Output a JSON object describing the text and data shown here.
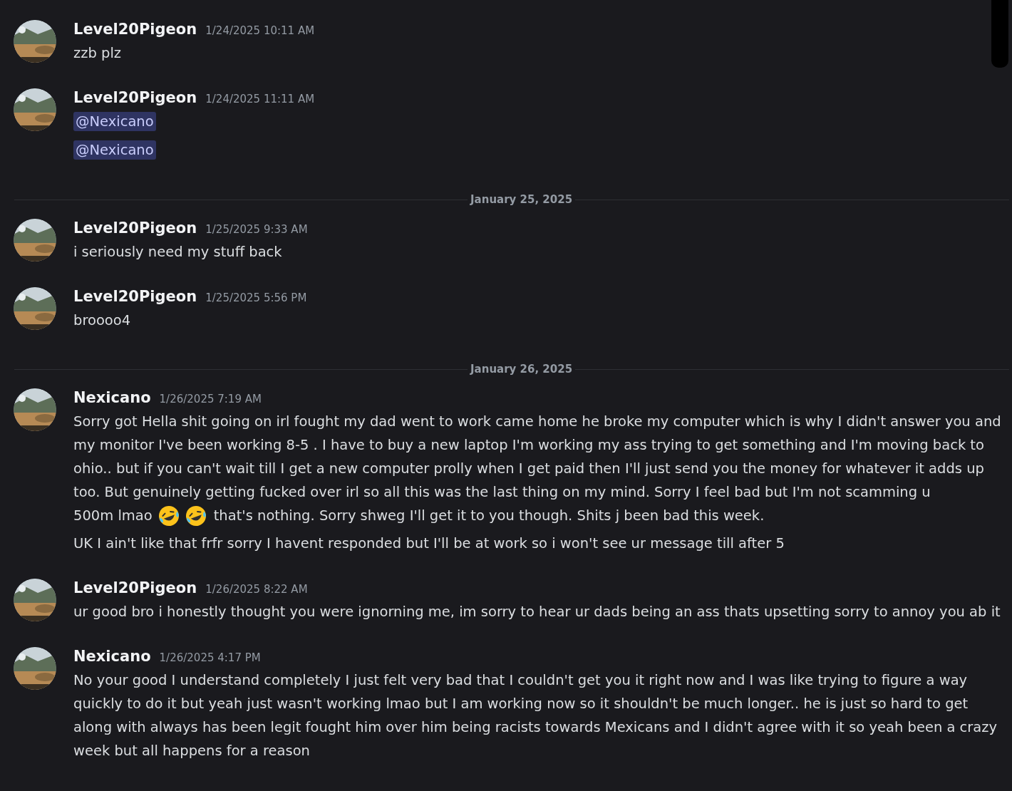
{
  "feed": [
    {
      "kind": "message",
      "author": "Level20Pigeon",
      "timestamp": "1/24/2025 10:11 AM",
      "avatar": {
        "kind": "picture"
      },
      "blocks": [
        {
          "kind": "text",
          "text": "zzb plz"
        }
      ]
    },
    {
      "kind": "message",
      "author": "Level20Pigeon",
      "timestamp": "1/24/2025 11:11 AM",
      "avatar": {
        "kind": "picture"
      },
      "blocks": [
        {
          "kind": "mention",
          "text": "@Nexicano"
        },
        {
          "kind": "mention",
          "text": "@Nexicano"
        }
      ]
    },
    {
      "kind": "divider",
      "date": "January 25, 2025"
    },
    {
      "kind": "message",
      "author": "Level20Pigeon",
      "timestamp": "1/25/2025 9:33 AM",
      "avatar": {
        "kind": "picture"
      },
      "blocks": [
        {
          "kind": "text",
          "text": "i seriously need my stuff back"
        }
      ]
    },
    {
      "kind": "message",
      "author": "Level20Pigeon",
      "timestamp": "1/25/2025 5:56 PM",
      "avatar": {
        "kind": "picture"
      },
      "blocks": [
        {
          "kind": "text",
          "text": "broooo4"
        }
      ]
    },
    {
      "kind": "divider",
      "date": "January 26, 2025"
    },
    {
      "kind": "message",
      "author": "Nexicano",
      "timestamp": "1/26/2025 7:19 AM",
      "avatar": {
        "kind": "picture"
      },
      "blocks": [
        {
          "kind": "text",
          "text": "Sorry got Hella shit going on irl fought my dad went to work came home he broke my computer which is why I didn't answer you and my monitor I've been working 8-5 . I have to buy a new laptop I'm working my ass trying to get something  and I'm moving back to ohio.. but if you can't wait till I get a new computer prolly when I get paid then I'll just send you the money for whatever it adds up too. But genuinely getting fucked over irl so all this was the last thing on my mind. Sorry I feel bad but I'm not scamming u"
        },
        {
          "kind": "inline",
          "parts": [
            {
              "kind": "text",
              "text": "500m lmao"
            },
            {
              "kind": "emoji"
            },
            {
              "kind": "emoji"
            },
            {
              "kind": "text",
              "text": "that's nothing. Sorry shweg I'll get it to you though. Shits j been bad this week."
            }
          ]
        },
        {
          "kind": "text",
          "text": "UK I ain't like that frfr sorry I havent responded but I'll be at work so i won't see ur message till after 5"
        }
      ]
    },
    {
      "kind": "message",
      "author": "Level20Pigeon",
      "timestamp": "1/26/2025 8:22 AM",
      "avatar": {
        "kind": "picture"
      },
      "blocks": [
        {
          "kind": "text",
          "text": "ur good bro i honestly thought you were ignorning me, im sorry to hear ur dads being an ass thats upsetting sorry to annoy you ab it"
        }
      ]
    },
    {
      "kind": "message",
      "author": "Nexicano",
      "timestamp": "1/26/2025 4:17 PM",
      "avatar": {
        "kind": "picture"
      },
      "blocks": [
        {
          "kind": "text",
          "text": "No your good I understand completely I just felt very bad that I couldn't get you it right now and I was like trying to figure a way quickly to do it but yeah just wasn't working lmao but I am working now so it shouldn't be much longer.. he is just so hard to get along with always has been legit fought him over him being racists towards Mexicans and I didn't agree with it so yeah been a crazy week but all happens for a reason"
        }
      ]
    }
  ]
}
